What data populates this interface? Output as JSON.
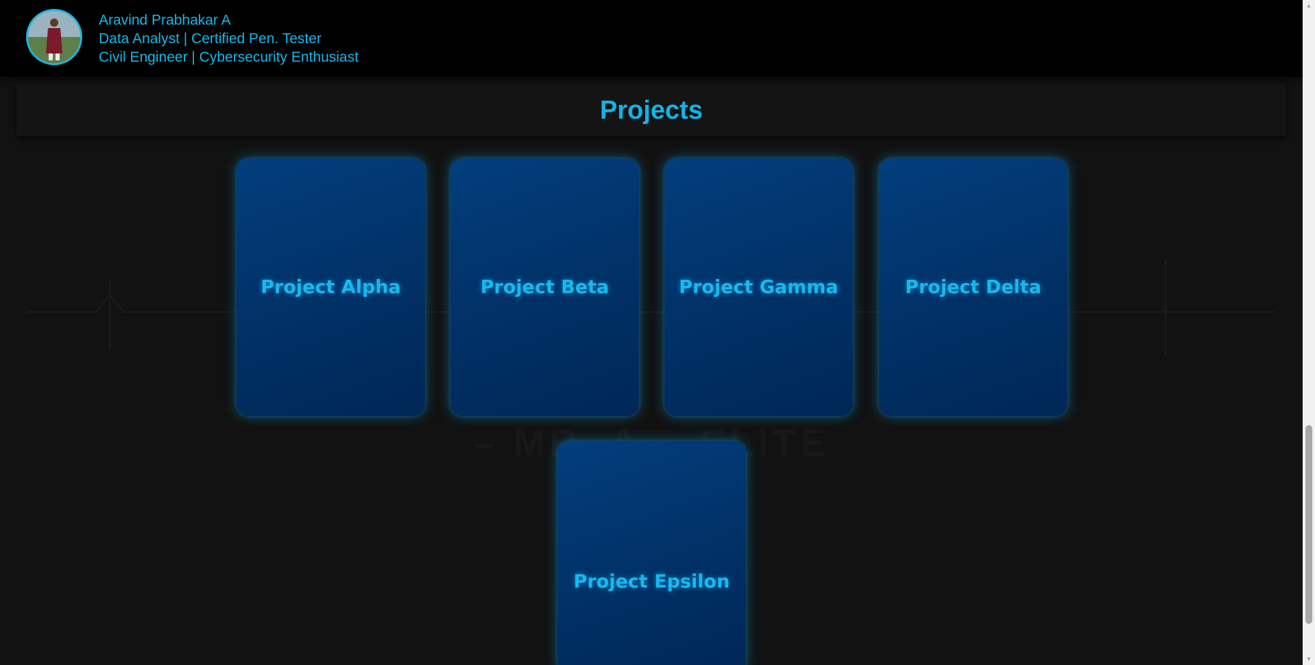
{
  "header": {
    "name": "Aravind Prabhakar A",
    "role": "Data Analyst | Certified Pen. Tester",
    "interests": "Civil Engineer | Cybersecurity Enthusiast"
  },
  "section": {
    "title": "Projects"
  },
  "projects": [
    {
      "title": "Project Alpha"
    },
    {
      "title": "Project Beta"
    },
    {
      "title": "Project Gamma"
    },
    {
      "title": "Project Delta"
    },
    {
      "title": "Project Epsilon"
    }
  ],
  "watermark": {
    "text": "– MR. A... ELITE"
  },
  "colors": {
    "accent": "#16b7e8",
    "card": "#013268",
    "background": "#121212",
    "header": "#000000"
  }
}
